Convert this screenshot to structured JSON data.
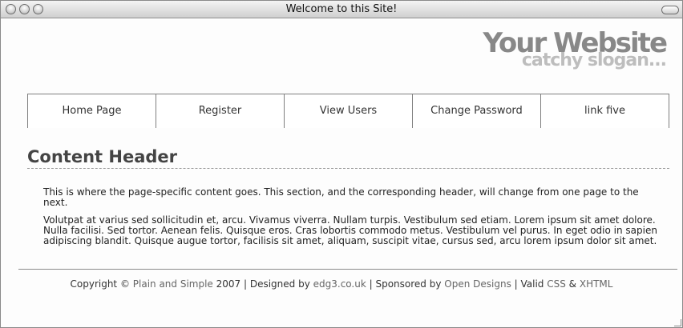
{
  "window": {
    "title": "Welcome to this Site!"
  },
  "logo": {
    "name": "Your Website",
    "slogan": "catchy slogan..."
  },
  "nav": {
    "items": [
      {
        "label": "Home Page"
      },
      {
        "label": "Register"
      },
      {
        "label": "View Users"
      },
      {
        "label": "Change Password"
      },
      {
        "label": "link five"
      }
    ]
  },
  "content": {
    "header": "Content Header",
    "intro": "This is where the page-specific content goes. This section, and the corresponding header, will change from one page to the next.",
    "body": "Volutpat at varius sed sollicitudin et, arcu. Vivamus viverra. Nullam turpis. Vestibulum sed etiam. Lorem ipsum sit amet dolore. Nulla facilisi. Sed tortor. Aenean felis. Quisque eros. Cras lobortis commodo metus. Vestibulum vel purus. In eget odio in sapien adipiscing blandit. Quisque augue tortor, facilisis sit amet, aliquam, suscipit vitae, cursus sed, arcu lorem ipsum dolor sit amet."
  },
  "footer": {
    "copyright_prefix": "Copyright © ",
    "site_link": "Plain and Simple",
    "year_text": " 2007 | Designed by ",
    "designer_link": "edg3.co.uk",
    "sponsor_text": " | Sponsored by ",
    "sponsor_link": "Open Designs",
    "valid_text": " | Valid ",
    "css_link": "CSS",
    "amp_text": " & ",
    "xhtml_link": "XHTML"
  },
  "icons": {
    "close": "close-button-icon",
    "minimize": "minimize-button-icon",
    "zoom": "zoom-button-icon",
    "toolbar_toggle": "toolbar-toggle-icon",
    "resize": "resize-grip-icon"
  }
}
